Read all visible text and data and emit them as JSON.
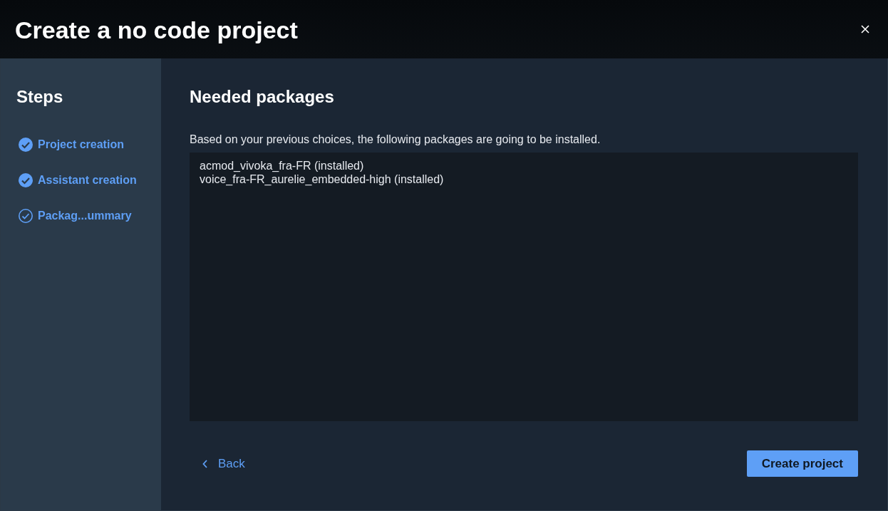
{
  "window": {
    "title": "Create a no code project"
  },
  "sidebar": {
    "title": "Steps",
    "steps": [
      {
        "label": "Project creation",
        "completed": true
      },
      {
        "label": "Assistant creation",
        "completed": true
      },
      {
        "label": "Packag...ummary",
        "completed": false
      }
    ]
  },
  "content": {
    "title": "Needed packages",
    "description": "Based on your previous choices, the following packages are going to be installed.",
    "packages": [
      "acmod_vivoka_fra-FR (installed)",
      "voice_fra-FR_aurelie_embedded-high (installed)"
    ]
  },
  "buttons": {
    "back": "Back",
    "create": "Create project"
  }
}
